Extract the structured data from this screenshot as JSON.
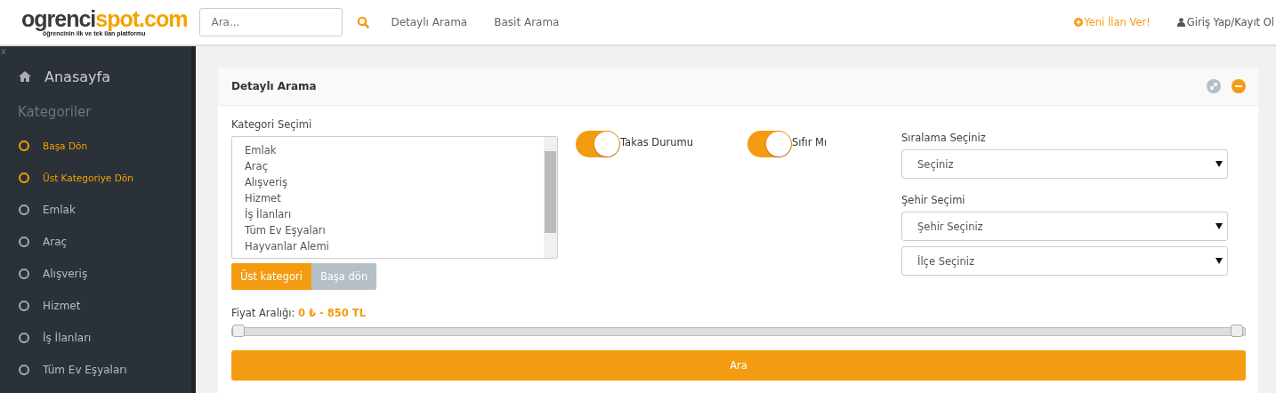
{
  "header": {
    "logo": {
      "dark": "ogrenci",
      "accent": "spot.com",
      "tagline": "öğrencinin ilk ve tek ilan platformu"
    },
    "search": {
      "placeholder": "Ara..."
    },
    "nav": [
      "Detaylı Arama",
      "Basit Arama"
    ],
    "post_ad": "Yeni İlan Ver!",
    "login": "Giriş Yap/Kayıt Ol"
  },
  "sidebar": {
    "close": "x",
    "home": "Anasayfa",
    "section": "Kategoriler",
    "items": [
      {
        "label": "Başa Dön",
        "highlighted": true
      },
      {
        "label": "Üst Kategoriye Dön",
        "highlighted": true
      },
      {
        "label": "Emlak",
        "highlighted": false
      },
      {
        "label": "Araç",
        "highlighted": false
      },
      {
        "label": "Alışveriş",
        "highlighted": false
      },
      {
        "label": "Hizmet",
        "highlighted": false
      },
      {
        "label": "İş İlanları",
        "highlighted": false
      },
      {
        "label": "Tüm Ev Eşyaları",
        "highlighted": false
      }
    ]
  },
  "panel": {
    "title": "Detaylı Arama",
    "category": {
      "label": "Kategori Seçimi",
      "options": [
        "Emlak",
        "Araç",
        "Alışveriş",
        "Hizmet",
        "İş İlanları",
        "Tüm Ev Eşyaları",
        "Hayvanlar Alemi"
      ],
      "buttons": [
        {
          "label": "Üst kategori",
          "kind": "primary"
        },
        {
          "label": "Başa dön",
          "kind": "secondary"
        }
      ]
    },
    "toggles": [
      {
        "label": "Takas Durumu",
        "on": true
      },
      {
        "label": "Sıfır Mı",
        "on": true
      }
    ],
    "sort": {
      "label": "Sıralama Seçiniz",
      "value": "Seçiniz"
    },
    "city": {
      "label": "Şehir Seçimi",
      "selects": [
        "Şehir Seçiniz",
        "İlçe Seçiniz"
      ]
    },
    "price": {
      "label": "Fiyat Aralığı:",
      "value": "0 ₺ - 850 TL",
      "thumbs": [
        {
          "level": 0
        },
        {
          "level": 1
        }
      ]
    },
    "submit": "Ara"
  }
}
